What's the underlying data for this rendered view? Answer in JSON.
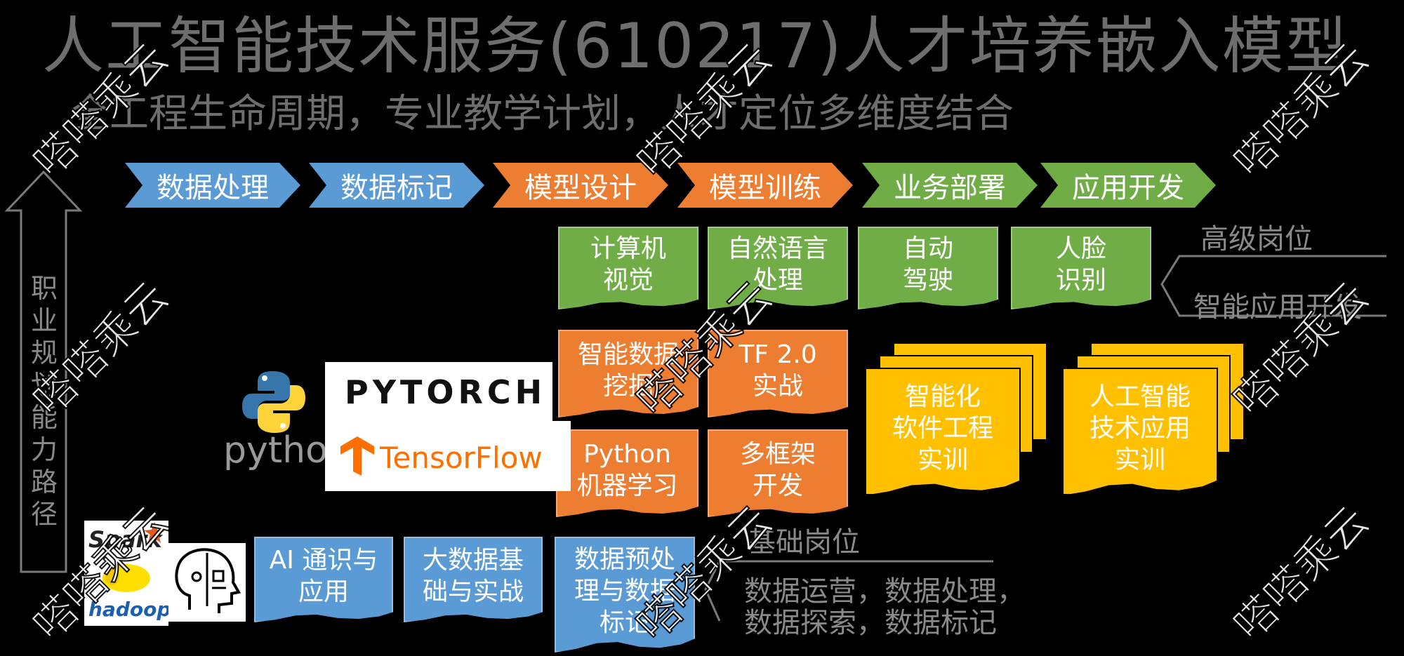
{
  "header": {
    "title": "人工智能技术服务(610217)人才培养嵌入模型",
    "subtitle": "全工程生命周期，专业教学计划，人才定位多维度结合"
  },
  "pipeline": [
    {
      "label": "数据处理",
      "color": "#5b9bd5"
    },
    {
      "label": "数据标记",
      "color": "#5b9bd5"
    },
    {
      "label": "模型设计",
      "color": "#ed7d31"
    },
    {
      "label": "模型训练",
      "color": "#ed7d31"
    },
    {
      "label": "业务部署",
      "color": "#70ad47"
    },
    {
      "label": "应用开发",
      "color": "#70ad47"
    }
  ],
  "applications": [
    "计算机\n视觉",
    "自然语言\n处理",
    "自动\n驾驶",
    "人脸\n识别"
  ],
  "frameworks_courses": [
    "智能数据\n挖掘",
    "TF 2.0\n实战",
    "Python\n机器学习",
    "多框架\n开发"
  ],
  "practicums": [
    "智能化\n软件工程\n实训",
    "人工智能\n技术应用\n实训"
  ],
  "basic_courses": [
    "AI 通识与\n应用",
    "大数据基\n础与实战",
    "数据预处\n理与数据\n标记"
  ],
  "career_path": "职\n业\n规\n划\n能\n力\n路\n径",
  "positions": {
    "advanced_title": "高级岗位",
    "advanced_detail": "智能应用开发",
    "basic_title": "基础岗位",
    "basic_detail_line1": "数据运营，数据处理，",
    "basic_detail_line2": "数据探索，数据标记"
  },
  "logos": {
    "python": "python",
    "pytorch": "PYTORCH",
    "tensorflow": "TensorFlow",
    "spark": "Spark",
    "hadoop": "hadoop"
  },
  "watermark": "嗒嗒乘云"
}
